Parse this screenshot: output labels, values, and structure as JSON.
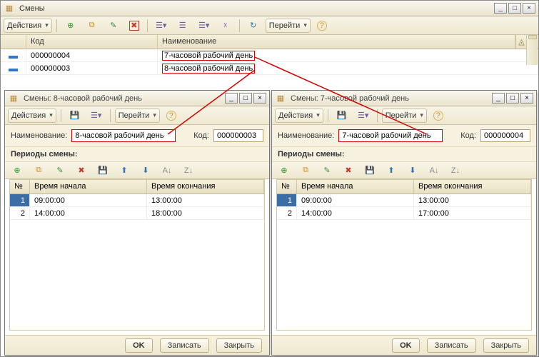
{
  "mainWindow": {
    "title": "Смены",
    "toolbar": {
      "actions": "Действия",
      "go": "Перейти"
    },
    "grid": {
      "headers": {
        "code": "Код",
        "name": "Наименование"
      },
      "rows": [
        {
          "code": "000000004",
          "name": "7-часовой рабочий день"
        },
        {
          "code": "000000003",
          "name": "8-часовой рабочий день"
        }
      ]
    }
  },
  "leftWindow": {
    "title": "Смены: 8-часовой рабочий день",
    "toolbar": {
      "actions": "Действия",
      "go": "Перейти"
    },
    "form": {
      "nameLabel": "Наименование:",
      "nameValue": "8-часовой рабочий день",
      "codeLabel": "Код:",
      "codeValue": "000000003"
    },
    "periodsLabel": "Периоды смены:",
    "periodsGrid": {
      "headers": {
        "num": "№",
        "start": "Время начала",
        "end": "Время окончания"
      },
      "rows": [
        {
          "num": "1",
          "start": "09:00:00",
          "end": "13:00:00"
        },
        {
          "num": "2",
          "start": "14:00:00",
          "end": "18:00:00"
        }
      ]
    },
    "footer": {
      "ok": "OK",
      "save": "Записать",
      "close": "Закрыть"
    }
  },
  "rightWindow": {
    "title": "Смены: 7-часовой рабочий день",
    "toolbar": {
      "actions": "Действия",
      "go": "Перейти"
    },
    "form": {
      "nameLabel": "Наименование:",
      "nameValue": "7-часовой рабочий день",
      "codeLabel": "Код:",
      "codeValue": "000000004"
    },
    "periodsLabel": "Периоды смены:",
    "periodsGrid": {
      "headers": {
        "num": "№",
        "start": "Время начала",
        "end": "Время окончания"
      },
      "rows": [
        {
          "num": "1",
          "start": "09:00:00",
          "end": "13:00:00"
        },
        {
          "num": "2",
          "start": "14:00:00",
          "end": "17:00:00"
        }
      ]
    },
    "footer": {
      "ok": "OK",
      "save": "Записать",
      "close": "Закрыть"
    }
  },
  "icons": {
    "listIcon": "☰",
    "addIcon": "＋",
    "add2Icon": "✚",
    "editIcon": "✎",
    "deleteIcon": "✖",
    "refreshIcon": "⟳",
    "helpIcon": "?",
    "filterIcon": "▼",
    "sortAscIcon": "A↓",
    "sortDescIcon": "Z↓",
    "upIcon": "⬆",
    "downIcon": "⬇",
    "saveIcon": "💾",
    "copyIcon": "⧉"
  }
}
